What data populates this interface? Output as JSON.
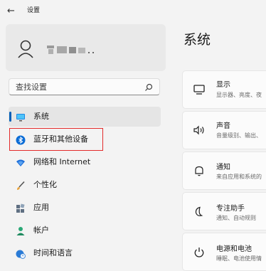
{
  "titlebar": {
    "back_glyph": "←",
    "app_title": "设置"
  },
  "sidebar": {
    "search": {
      "value": "查找设置",
      "icon": "search-icon"
    },
    "items": [
      {
        "label": "系统",
        "icon": "system-monitor-icon",
        "active": true
      },
      {
        "label": "蓝牙和其他设备",
        "icon": "bluetooth-icon",
        "active": false
      },
      {
        "label": "网络和 Internet",
        "icon": "wifi-icon",
        "active": false
      },
      {
        "label": "个性化",
        "icon": "brush-icon",
        "active": false
      },
      {
        "label": "应用",
        "icon": "apps-icon",
        "active": false
      },
      {
        "label": "帐户",
        "icon": "person-icon",
        "active": false
      },
      {
        "label": "时间和语言",
        "icon": "globe-clock-icon",
        "active": false
      }
    ]
  },
  "main": {
    "title": "系统",
    "cards": [
      {
        "title": "显示",
        "subtitle": "显示器、亮度、夜",
        "icon": "display-icon"
      },
      {
        "title": "声音",
        "subtitle": "音量级别、输出、",
        "icon": "speaker-icon"
      },
      {
        "title": "通知",
        "subtitle": "来自应用和系统的",
        "icon": "bell-icon"
      },
      {
        "title": "专注助手",
        "subtitle": "通知、自动规则",
        "icon": "moon-icon"
      },
      {
        "title": "电源和电池",
        "subtitle": "睡眠、电池使用情",
        "icon": "power-icon"
      }
    ]
  },
  "colors": {
    "accent": "#005fb8",
    "highlight_border": "#e32b2b",
    "bluetooth": "#0a6cd6"
  }
}
